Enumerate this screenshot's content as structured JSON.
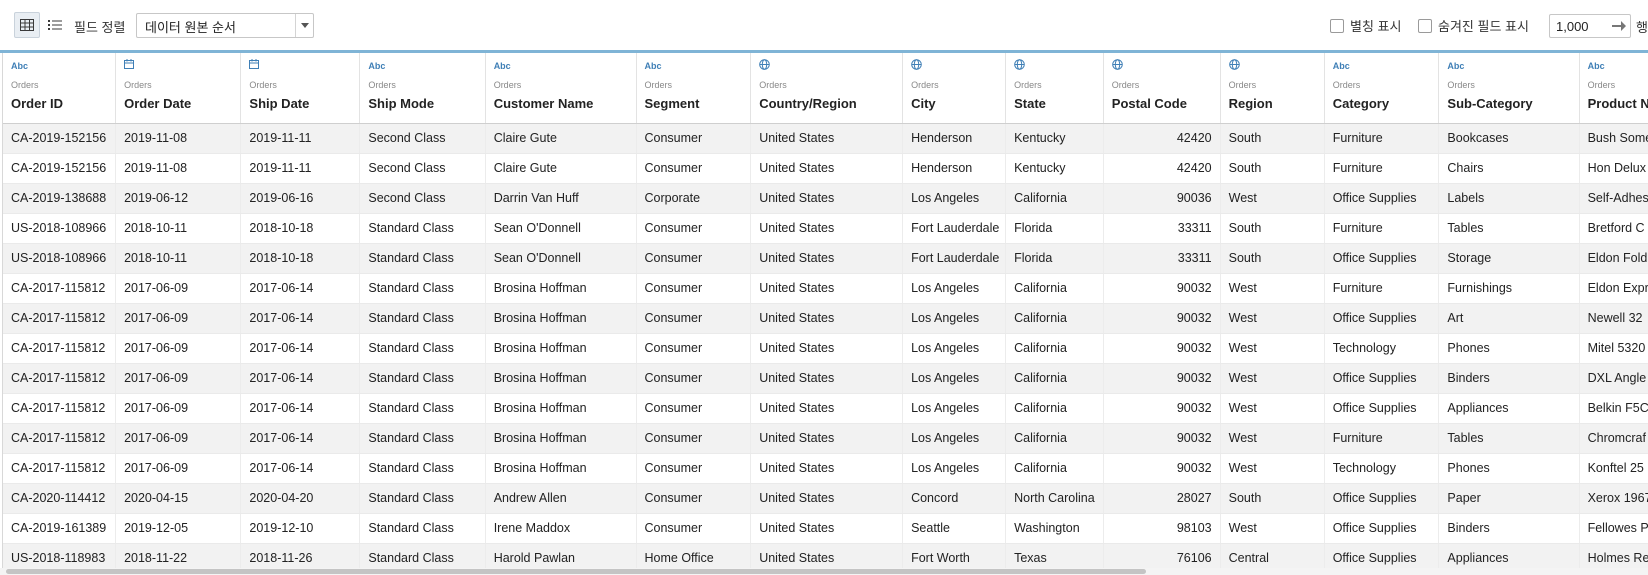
{
  "toolbar": {
    "sort_label": "필드 정렬",
    "sort_value": "데이터 원본 순서",
    "alias_label": "별칭 표시",
    "hidden_label": "숨겨진 필드 표시",
    "rows_value": "1,000",
    "rows_suffix": "행"
  },
  "colors": {
    "accent": "#7fb4d6",
    "icon": "#3f7fb6"
  },
  "columns": [
    {
      "icon": "Abc",
      "type": "string",
      "source": "Orders",
      "name": "Order ID"
    },
    {
      "icon": "calendar-icon",
      "type": "date",
      "source": "Orders",
      "name": "Order Date"
    },
    {
      "icon": "calendar-icon",
      "type": "date",
      "source": "Orders",
      "name": "Ship Date"
    },
    {
      "icon": "Abc",
      "type": "string",
      "source": "Orders",
      "name": "Ship Mode"
    },
    {
      "icon": "Abc",
      "type": "string",
      "source": "Orders",
      "name": "Customer Name"
    },
    {
      "icon": "Abc",
      "type": "string",
      "source": "Orders",
      "name": "Segment"
    },
    {
      "icon": "globe-icon",
      "type": "geo",
      "source": "Orders",
      "name": "Country/Region"
    },
    {
      "icon": "globe-icon",
      "type": "geo",
      "source": "Orders",
      "name": "City"
    },
    {
      "icon": "globe-icon",
      "type": "geo",
      "source": "Orders",
      "name": "State"
    },
    {
      "icon": "globe-icon",
      "type": "geo",
      "source": "Orders",
      "name": "Postal Code"
    },
    {
      "icon": "globe-icon",
      "type": "geo",
      "source": "Orders",
      "name": "Region"
    },
    {
      "icon": "Abc",
      "type": "string",
      "source": "Orders",
      "name": "Category"
    },
    {
      "icon": "Abc",
      "type": "string",
      "source": "Orders",
      "name": "Sub-Category"
    },
    {
      "icon": "Abc",
      "type": "string",
      "source": "Orders",
      "name": "Product Na"
    }
  ],
  "rows": [
    [
      "CA-2019-152156",
      "2019-11-08",
      "2019-11-11",
      "Second Class",
      "Claire Gute",
      "Consumer",
      "United States",
      "Henderson",
      "Kentucky",
      "42420",
      "South",
      "Furniture",
      "Bookcases",
      "Bush Some"
    ],
    [
      "CA-2019-152156",
      "2019-11-08",
      "2019-11-11",
      "Second Class",
      "Claire Gute",
      "Consumer",
      "United States",
      "Henderson",
      "Kentucky",
      "42420",
      "South",
      "Furniture",
      "Chairs",
      "Hon Delux"
    ],
    [
      "CA-2019-138688",
      "2019-06-12",
      "2019-06-16",
      "Second Class",
      "Darrin Van Huff",
      "Corporate",
      "United States",
      "Los Angeles",
      "California",
      "90036",
      "West",
      "Office Supplies",
      "Labels",
      "Self-Adhes"
    ],
    [
      "US-2018-108966",
      "2018-10-11",
      "2018-10-18",
      "Standard Class",
      "Sean O'Donnell",
      "Consumer",
      "United States",
      "Fort Lauderdale",
      "Florida",
      "33311",
      "South",
      "Furniture",
      "Tables",
      "Bretford C"
    ],
    [
      "US-2018-108966",
      "2018-10-11",
      "2018-10-18",
      "Standard Class",
      "Sean O'Donnell",
      "Consumer",
      "United States",
      "Fort Lauderdale",
      "Florida",
      "33311",
      "South",
      "Office Supplies",
      "Storage",
      "Eldon Fold"
    ],
    [
      "CA-2017-115812",
      "2017-06-09",
      "2017-06-14",
      "Standard Class",
      "Brosina Hoffman",
      "Consumer",
      "United States",
      "Los Angeles",
      "California",
      "90032",
      "West",
      "Furniture",
      "Furnishings",
      "Eldon Expr"
    ],
    [
      "CA-2017-115812",
      "2017-06-09",
      "2017-06-14",
      "Standard Class",
      "Brosina Hoffman",
      "Consumer",
      "United States",
      "Los Angeles",
      "California",
      "90032",
      "West",
      "Office Supplies",
      "Art",
      "Newell 32"
    ],
    [
      "CA-2017-115812",
      "2017-06-09",
      "2017-06-14",
      "Standard Class",
      "Brosina Hoffman",
      "Consumer",
      "United States",
      "Los Angeles",
      "California",
      "90032",
      "West",
      "Technology",
      "Phones",
      "Mitel 5320"
    ],
    [
      "CA-2017-115812",
      "2017-06-09",
      "2017-06-14",
      "Standard Class",
      "Brosina Hoffman",
      "Consumer",
      "United States",
      "Los Angeles",
      "California",
      "90032",
      "West",
      "Office Supplies",
      "Binders",
      "DXL Angle"
    ],
    [
      "CA-2017-115812",
      "2017-06-09",
      "2017-06-14",
      "Standard Class",
      "Brosina Hoffman",
      "Consumer",
      "United States",
      "Los Angeles",
      "California",
      "90032",
      "West",
      "Office Supplies",
      "Appliances",
      "Belkin F5C"
    ],
    [
      "CA-2017-115812",
      "2017-06-09",
      "2017-06-14",
      "Standard Class",
      "Brosina Hoffman",
      "Consumer",
      "United States",
      "Los Angeles",
      "California",
      "90032",
      "West",
      "Furniture",
      "Tables",
      "Chromcraf"
    ],
    [
      "CA-2017-115812",
      "2017-06-09",
      "2017-06-14",
      "Standard Class",
      "Brosina Hoffman",
      "Consumer",
      "United States",
      "Los Angeles",
      "California",
      "90032",
      "West",
      "Technology",
      "Phones",
      "Konftel 25"
    ],
    [
      "CA-2020-114412",
      "2020-04-15",
      "2020-04-20",
      "Standard Class",
      "Andrew Allen",
      "Consumer",
      "United States",
      "Concord",
      "North Carolina",
      "28027",
      "South",
      "Office Supplies",
      "Paper",
      "Xerox 1967"
    ],
    [
      "CA-2019-161389",
      "2019-12-05",
      "2019-12-10",
      "Standard Class",
      "Irene Maddox",
      "Consumer",
      "United States",
      "Seattle",
      "Washington",
      "98103",
      "West",
      "Office Supplies",
      "Binders",
      "Fellowes P"
    ],
    [
      "US-2018-118983",
      "2018-11-22",
      "2018-11-26",
      "Standard Class",
      "Harold Pawlan",
      "Home Office",
      "United States",
      "Fort Worth",
      "Texas",
      "76106",
      "Central",
      "Office Supplies",
      "Appliances",
      "Holmes Re"
    ]
  ]
}
